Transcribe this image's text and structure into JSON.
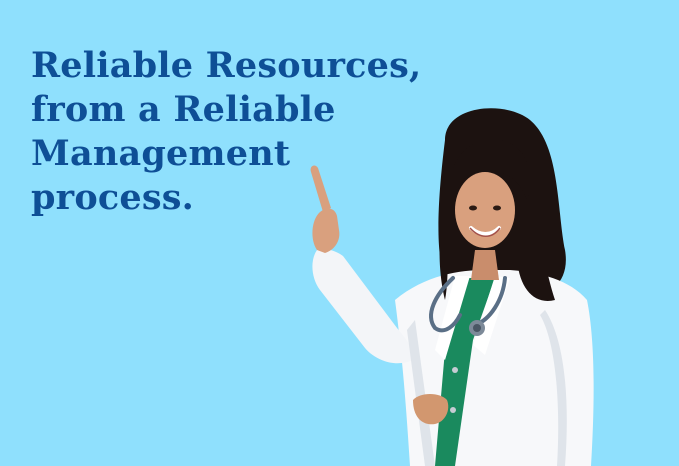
{
  "headline": {
    "lines": [
      "Reliable Resources,",
      "from a Reliable",
      "Management",
      "process."
    ]
  },
  "colors": {
    "background": "#8fe0fd",
    "headline": "#0e4f96",
    "coat": "#ffffff",
    "scrubs": "#1a8a5e",
    "hair": "#1c1210",
    "skin": "#d9a07e",
    "stethoscope": "#5a6f86"
  },
  "illustration": {
    "subject": "doctor-pointing-icon"
  }
}
